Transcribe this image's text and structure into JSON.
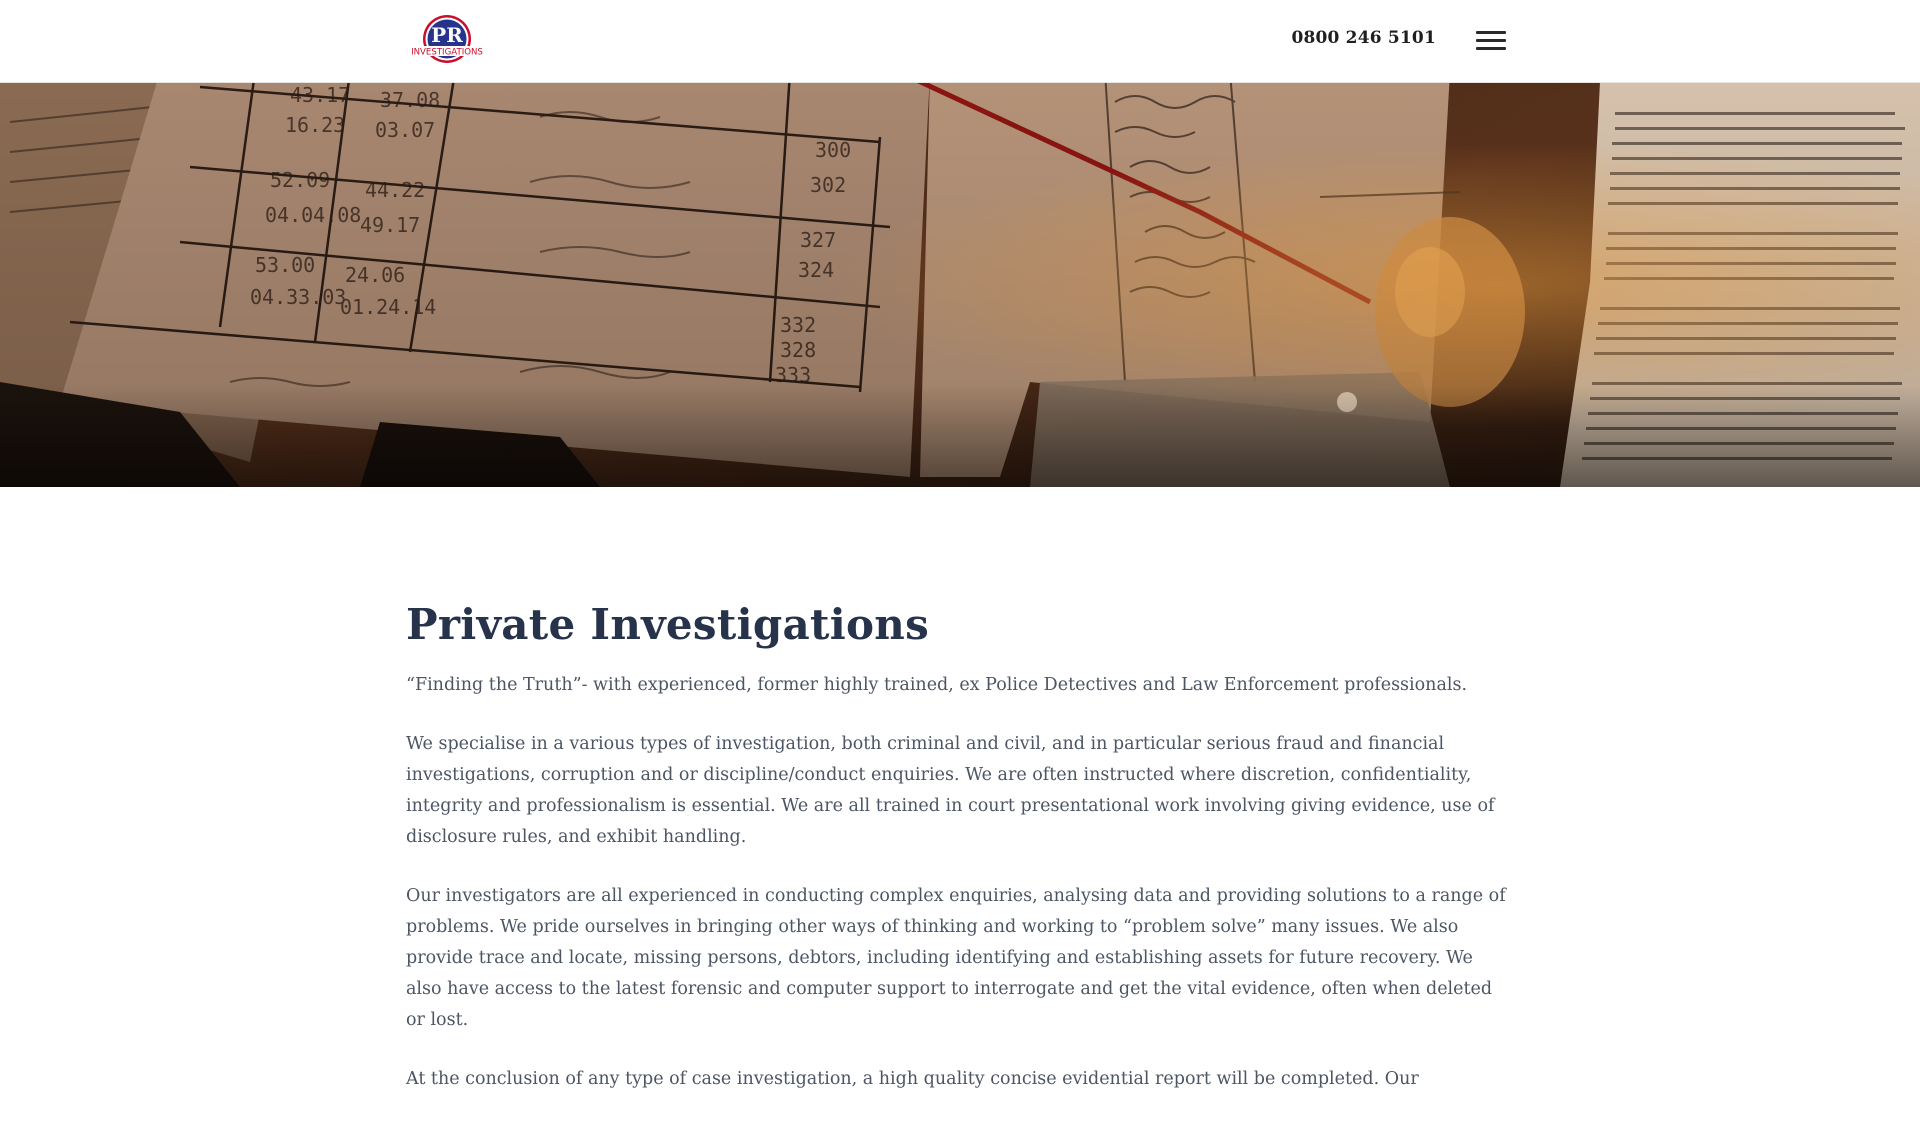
{
  "header": {
    "logo": {
      "initials": "PR",
      "wordmark": "INVESTIGATIONS"
    },
    "phone": "0800 246 5101",
    "menu_icon": "hamburger-icon"
  },
  "main": {
    "title": "Private Investigations",
    "paragraphs": [
      "“Finding the Truth”- with experienced, former highly trained, ex Police Detectives and Law Enforcement professionals.",
      "We specialise in a various types of investigation, both criminal and civil, and in particular serious fraud and financial investigations, corruption and or discipline/conduct enquiries. We are often instructed where discretion, confidentiality, integrity and professionalism is essential. We are all trained in court presentational work involving giving evidence, use of disclosure rules, and exhibit handling.",
      "Our investigators are all experienced in conducting complex enquiries, analysing data and providing solutions to a range of problems. We pride ourselves in bringing other ways of thinking and working to “problem solve” many issues. We also provide trace and locate, missing persons, debtors, including identifying and establishing assets for future recovery. We also have access to the latest forensic and computer support to interrogate and get the vital evidence, often when deleted or lost.",
      "At the conclusion of any type of case investigation, a high quality concise evidential report will be completed. Our"
    ]
  },
  "colors": {
    "title": "#26334a",
    "body_text": "#4c5563",
    "logo_blue": "#27348b",
    "logo_red": "#c8102e"
  }
}
